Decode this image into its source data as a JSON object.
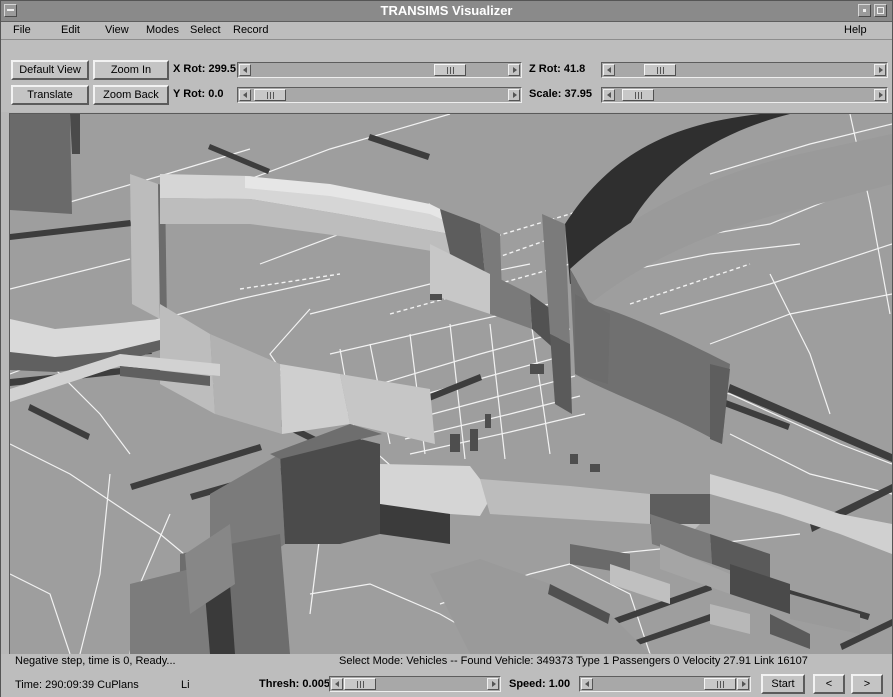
{
  "window": {
    "title": "TRANSIMS Visualizer"
  },
  "menubar": {
    "file": "File",
    "edit": "Edit",
    "view": "View",
    "modes": "Modes",
    "select": "Select",
    "record": "Record",
    "help": "Help"
  },
  "controls": {
    "default_view": "Default View",
    "zoom_in": "Zoom In",
    "translate": "Translate",
    "zoom_back": "Zoom Back",
    "x_rot_label": "X Rot:",
    "x_rot_value": "299.5",
    "y_rot_label": "Y Rot:",
    "y_rot_value": "0.0",
    "z_rot_label": "Z Rot:",
    "z_rot_value": "41.8",
    "scale_label": "Scale:",
    "scale_value": "37.95"
  },
  "status": {
    "message": "Negative step, time is 0, Ready...",
    "selection": "Select Mode: Vehicles -- Found Vehicle: 349373 Type 1 Passengers 0 Velocity 27.91 Link 16107",
    "time": "Time: 290:09:39 CuPlans",
    "li": "Li",
    "thresh_label": "Thresh:",
    "thresh_value": "0.005",
    "speed_label": "Speed:",
    "speed_value": "1.00",
    "start": "Start",
    "prev": "<",
    "next": ">"
  },
  "colors": {
    "ground": "#9e9e9e",
    "road_lines": "#f2f2f2",
    "wall_dark": "#3a3a3a",
    "wall_mid": "#6e6e6e",
    "wall_light": "#d2d2d2"
  }
}
